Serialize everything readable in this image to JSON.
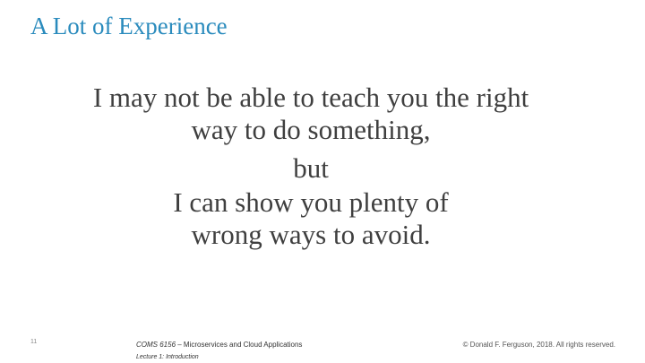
{
  "slide": {
    "title": "A Lot of Experience",
    "body_lines": [
      "I may not be able to teach you the right",
      "way to do something,",
      "but",
      "I can show you plenty of",
      "wrong ways to avoid."
    ],
    "footer": {
      "page_number": "11",
      "course_code": "COMS 6156",
      "course_title": " – Microservices and Cloud Applications",
      "lecture": "Lecture 1: Introduction",
      "copyright": "© Donald F. Ferguson, 2018. All rights reserved."
    }
  },
  "colors": {
    "title": "#2a8bbd",
    "body_text": "#3f3f3f",
    "background": "#ffffff"
  }
}
